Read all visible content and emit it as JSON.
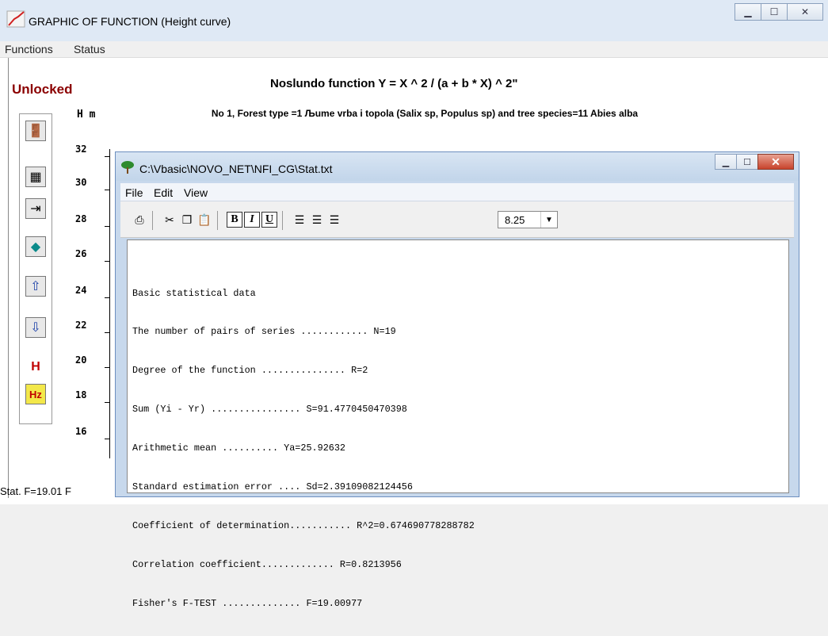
{
  "window": {
    "title": "GRAPHIC OF FUNCTION (Height curve)"
  },
  "menu": [
    "Functions",
    "Status"
  ],
  "lock_status": "Unlocked",
  "function_title": "Noslundo function  Y = X ^ 2 / (a + b * X) ^ 2\"",
  "function_subtitle": "No 1, Forest type =1 Љume vrba i topola (Salix sp, Populus sp) and tree species=11 Abies alba",
  "y_axis": {
    "label": "H m",
    "ticks": [
      "32",
      "30",
      "28",
      "26",
      "24",
      "22",
      "20",
      "18",
      "16"
    ]
  },
  "toolbar": {
    "h_label": "H",
    "hz_label": "Hz"
  },
  "status_text": "Stat. F=19.01 F",
  "child": {
    "title": "C:\\Vbasic\\NOVO_NET\\NFI_CG\\Stat.txt",
    "menu": [
      "File",
      "Edit",
      "View"
    ],
    "format": {
      "bold": "B",
      "italic": "I",
      "underline": "U"
    },
    "font_size": "8.25",
    "lines": [
      "Basic statistical data",
      "The number of pairs of series ............ N=19",
      "Degree of the function ............... R=2",
      "Sum (Yi - Yr) ................ S=91.4770450470398",
      "Arithmetic mean .......... Ya=25.92632",
      "Standard estimation error .... Sd=2.39109082124456",
      "Coefficient of determination........... R^2=0.674690778288782",
      "Correlation coefficient............. R=0.8213956",
      "Fisher's F-TEST .............. F=19.00977"
    ]
  }
}
